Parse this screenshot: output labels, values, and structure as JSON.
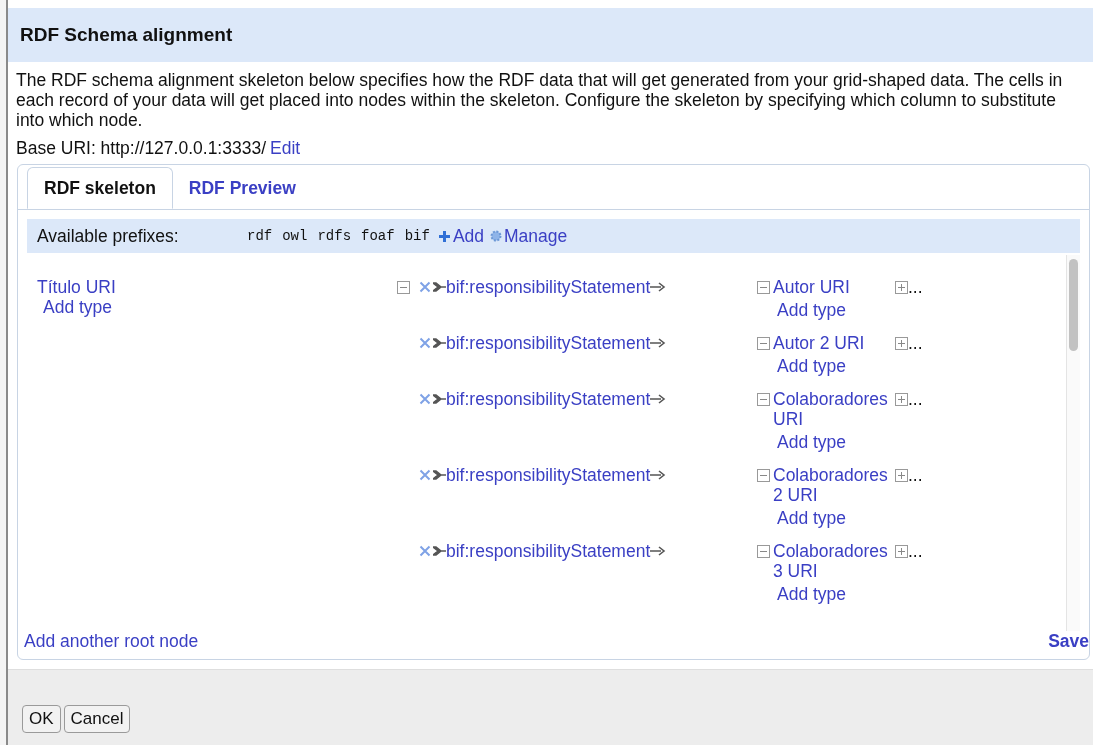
{
  "dialog": {
    "title": "RDF Schema alignment",
    "description": "The RDF schema alignment skeleton below specifies how the RDF data that will get generated from your grid-shaped data. The cells in each record of your data will get placed into nodes within the skeleton. Configure the skeleton by specifying which column to substitute into which node.",
    "base_uri": {
      "label": "Base URI: http://127.0.0.1:3333/",
      "edit": "Edit"
    },
    "tabs": [
      {
        "label": "RDF skeleton",
        "selected": true
      },
      {
        "label": "RDF Preview",
        "selected": false
      }
    ],
    "prefixes": {
      "label": "Available prefixes:",
      "items": [
        "rdf",
        "owl",
        "rdfs",
        "foaf",
        "bif"
      ],
      "add": "Add",
      "manage": "Manage"
    },
    "root": {
      "label": "Título URI",
      "add_type": "Add type",
      "expanded": true,
      "links": [
        {
          "property": "bif:responsibilityStatement",
          "target": {
            "label": "Autor URI",
            "expanded": true,
            "add_type": "Add type",
            "more": "..."
          }
        },
        {
          "property": "bif:responsibilityStatement",
          "target": {
            "label": "Autor 2 URI",
            "expanded": true,
            "add_type": "Add type",
            "more": "..."
          }
        },
        {
          "property": "bif:responsibilityStatement",
          "target": {
            "label": "Colaboradores URI",
            "expanded": true,
            "add_type": "Add type",
            "more": "..."
          }
        },
        {
          "property": "bif:responsibilityStatement",
          "target": {
            "label": "Colaboradores 2 URI",
            "expanded": true,
            "add_type": "Add type",
            "more": "..."
          }
        },
        {
          "property": "bif:responsibilityStatement",
          "target": {
            "label": "Colaboradores 3 URI",
            "expanded": true,
            "add_type": "Add type",
            "more": "..."
          }
        }
      ]
    },
    "add_root": "Add another root node",
    "save": "Save",
    "buttons": [
      "OK",
      "Cancel"
    ]
  }
}
